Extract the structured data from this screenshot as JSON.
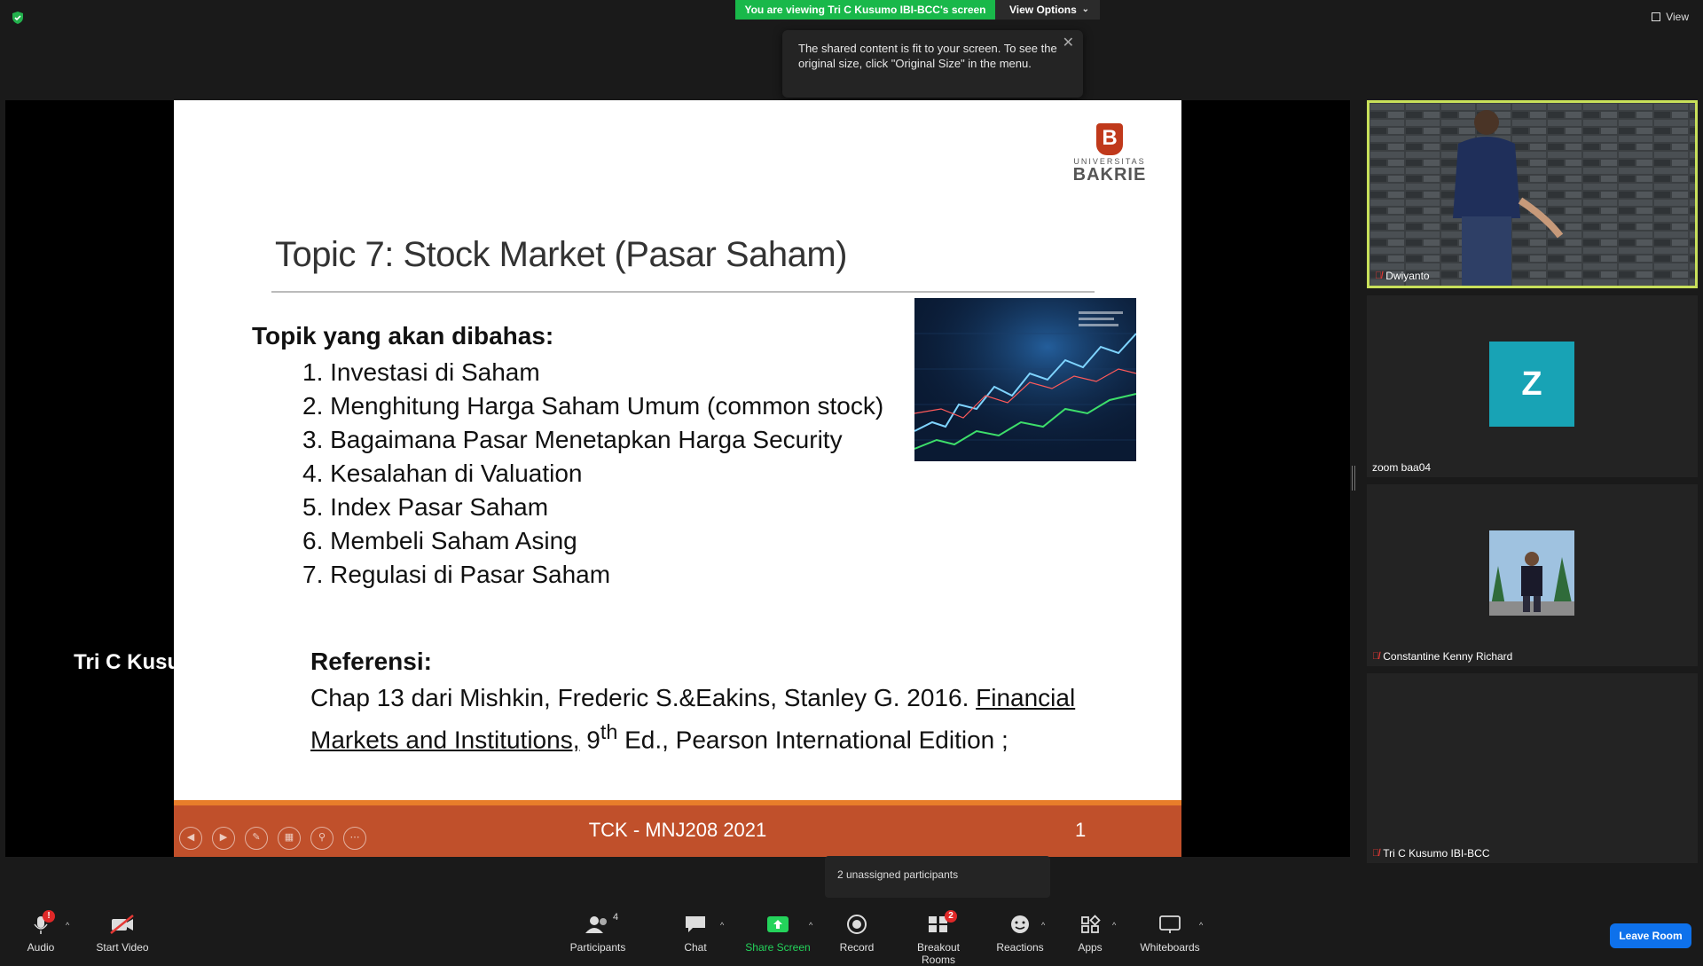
{
  "header": {
    "viewing_banner": "You are viewing Tri C Kusumo IBI-BCC's screen",
    "view_options_label": "View Options",
    "view_label": "View"
  },
  "tooltip": {
    "text": "The shared content is fit to your screen. To see the original size, click \"Original Size\" in the menu."
  },
  "slide": {
    "logo_sub": "UNIVERSITAS",
    "logo_name": "BAKRIE",
    "logo_letter": "B",
    "title": "Topic 7: Stock Market (Pasar Saham)",
    "topics_heading": "Topik yang akan dibahas:",
    "topics": [
      "1. Investasi di Saham",
      "2. Menghitung  Harga Saham Umum (common stock)",
      "3.  Bagaimana Pasar Menetapkan Harga Security",
      "4. Kesalahan di Valuation",
      "5. Index  Pasar Saham",
      "6. Membeli Saham Asing",
      "7. Regulasi di Pasar Saham"
    ],
    "ref_heading": "Referensi:",
    "ref_prefix": "Chap 13 dari Mishkin, Frederic S.&Eakins, Stanley G. 2016. ",
    "ref_book": "Financial Markets and Institutions,",
    "ref_ed_num": " 9",
    "ref_ed_sup": "th",
    "ref_suffix": " Ed., Pearson International Edition ;",
    "footer": "TCK - MNJ208 2021",
    "page_number": "1"
  },
  "participants": [
    {
      "name": "Dwiyanto",
      "muted": true
    },
    {
      "name": "zoom baa04",
      "muted": false,
      "initial": "Z"
    },
    {
      "name": "Constantine Kenny Richard",
      "muted": true
    },
    {
      "name": "Tri C Kusumo IBI-BCC",
      "muted": true,
      "display_name": "Tri C Kusumo IB..."
    }
  ],
  "unassigned": "2 unassigned participants",
  "toolbar": {
    "audio": "Audio",
    "audio_badge": "!",
    "start_video": "Start Video",
    "participants": "Participants",
    "participants_count": "4",
    "chat": "Chat",
    "share_screen": "Share Screen",
    "record": "Record",
    "breakout_rooms": "Breakout Rooms",
    "breakout_badge": "2",
    "reactions": "Reactions",
    "apps": "Apps",
    "whiteboards": "Whiteboards",
    "leave": "Leave Room"
  },
  "colors": {
    "banner_green": "#19b84a",
    "speaker_border": "#c8e05a",
    "slide_footer": "#c0502b",
    "leave_blue": "#0e71eb",
    "avatar_teal": "#18a3b5"
  }
}
